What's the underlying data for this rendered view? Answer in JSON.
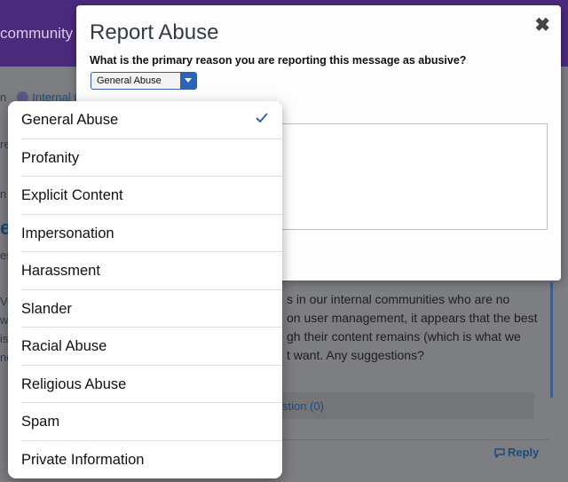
{
  "background": {
    "brand_text": "community",
    "crumb_prefix": "n",
    "crumb_link": "Internal C",
    "side_letters": [
      "re",
      "n I"
    ],
    "title_fragment": "el",
    "subtitle_fragment": "es",
    "body_lines": [
      "s in our internal communities who are no",
      "on user management, it appears that the best",
      "gh their content remains (which is what we",
      "t want. Any suggestions?"
    ],
    "left_fragments": [
      "Ve",
      "wit",
      "is",
      "ne"
    ],
    "suggest_link": "stion (0)",
    "reply_label": "Reply"
  },
  "modal": {
    "title": "Report Abuse",
    "close_glyph": "✖",
    "question": "What is the primary reason you are reporting this message as abusive?",
    "selected_value": "General Abuse"
  },
  "dropdown": {
    "selected_index": 0,
    "options": [
      "General Abuse",
      "Profanity",
      "Explicit Content",
      "Impersonation",
      "Harassment",
      "Slander",
      "Racial Abuse",
      "Religious Abuse",
      "Spam",
      "Private Information"
    ]
  },
  "colors": {
    "header": "#4b2a7c",
    "accent": "#2b63b8",
    "check": "#2b63b8"
  }
}
